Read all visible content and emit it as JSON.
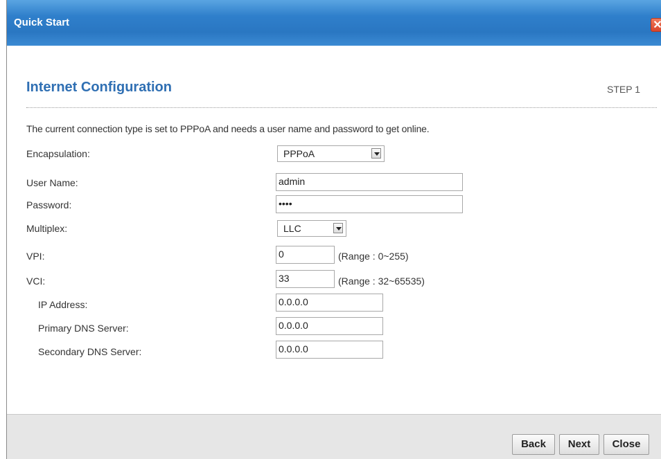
{
  "window": {
    "title": "Quick Start",
    "close_glyph": "✕"
  },
  "heading": "Internet Configuration",
  "step": "STEP 1",
  "intro": "The current connection type is set to PPPoA and needs a user name and password to get online.",
  "form": {
    "encapsulation": {
      "label": "Encapsulation:",
      "value": "PPPoA"
    },
    "username": {
      "label": "User Name:",
      "value": "admin"
    },
    "password": {
      "label": "Password:",
      "value": "••••"
    },
    "multiplex": {
      "label": "Multiplex:",
      "value": "LLC"
    },
    "vpi": {
      "label": "VPI:",
      "value": "0",
      "range": "(Range : 0~255)"
    },
    "vci": {
      "label": "VCI:",
      "value": "33",
      "range": "(Range : 32~65535)"
    },
    "ip_address": {
      "label": "IP Address:",
      "value": "0.0.0.0"
    },
    "primary_dns": {
      "label": "Primary DNS Server:",
      "value": "0.0.0.0"
    },
    "secondary_dns": {
      "label": "Secondary DNS Server:",
      "value": "0.0.0.0"
    }
  },
  "buttons": {
    "back": "Back",
    "next": "Next",
    "close": "Close"
  },
  "icons": {
    "close": "close-icon",
    "dropdown": "chevron-down-icon"
  }
}
